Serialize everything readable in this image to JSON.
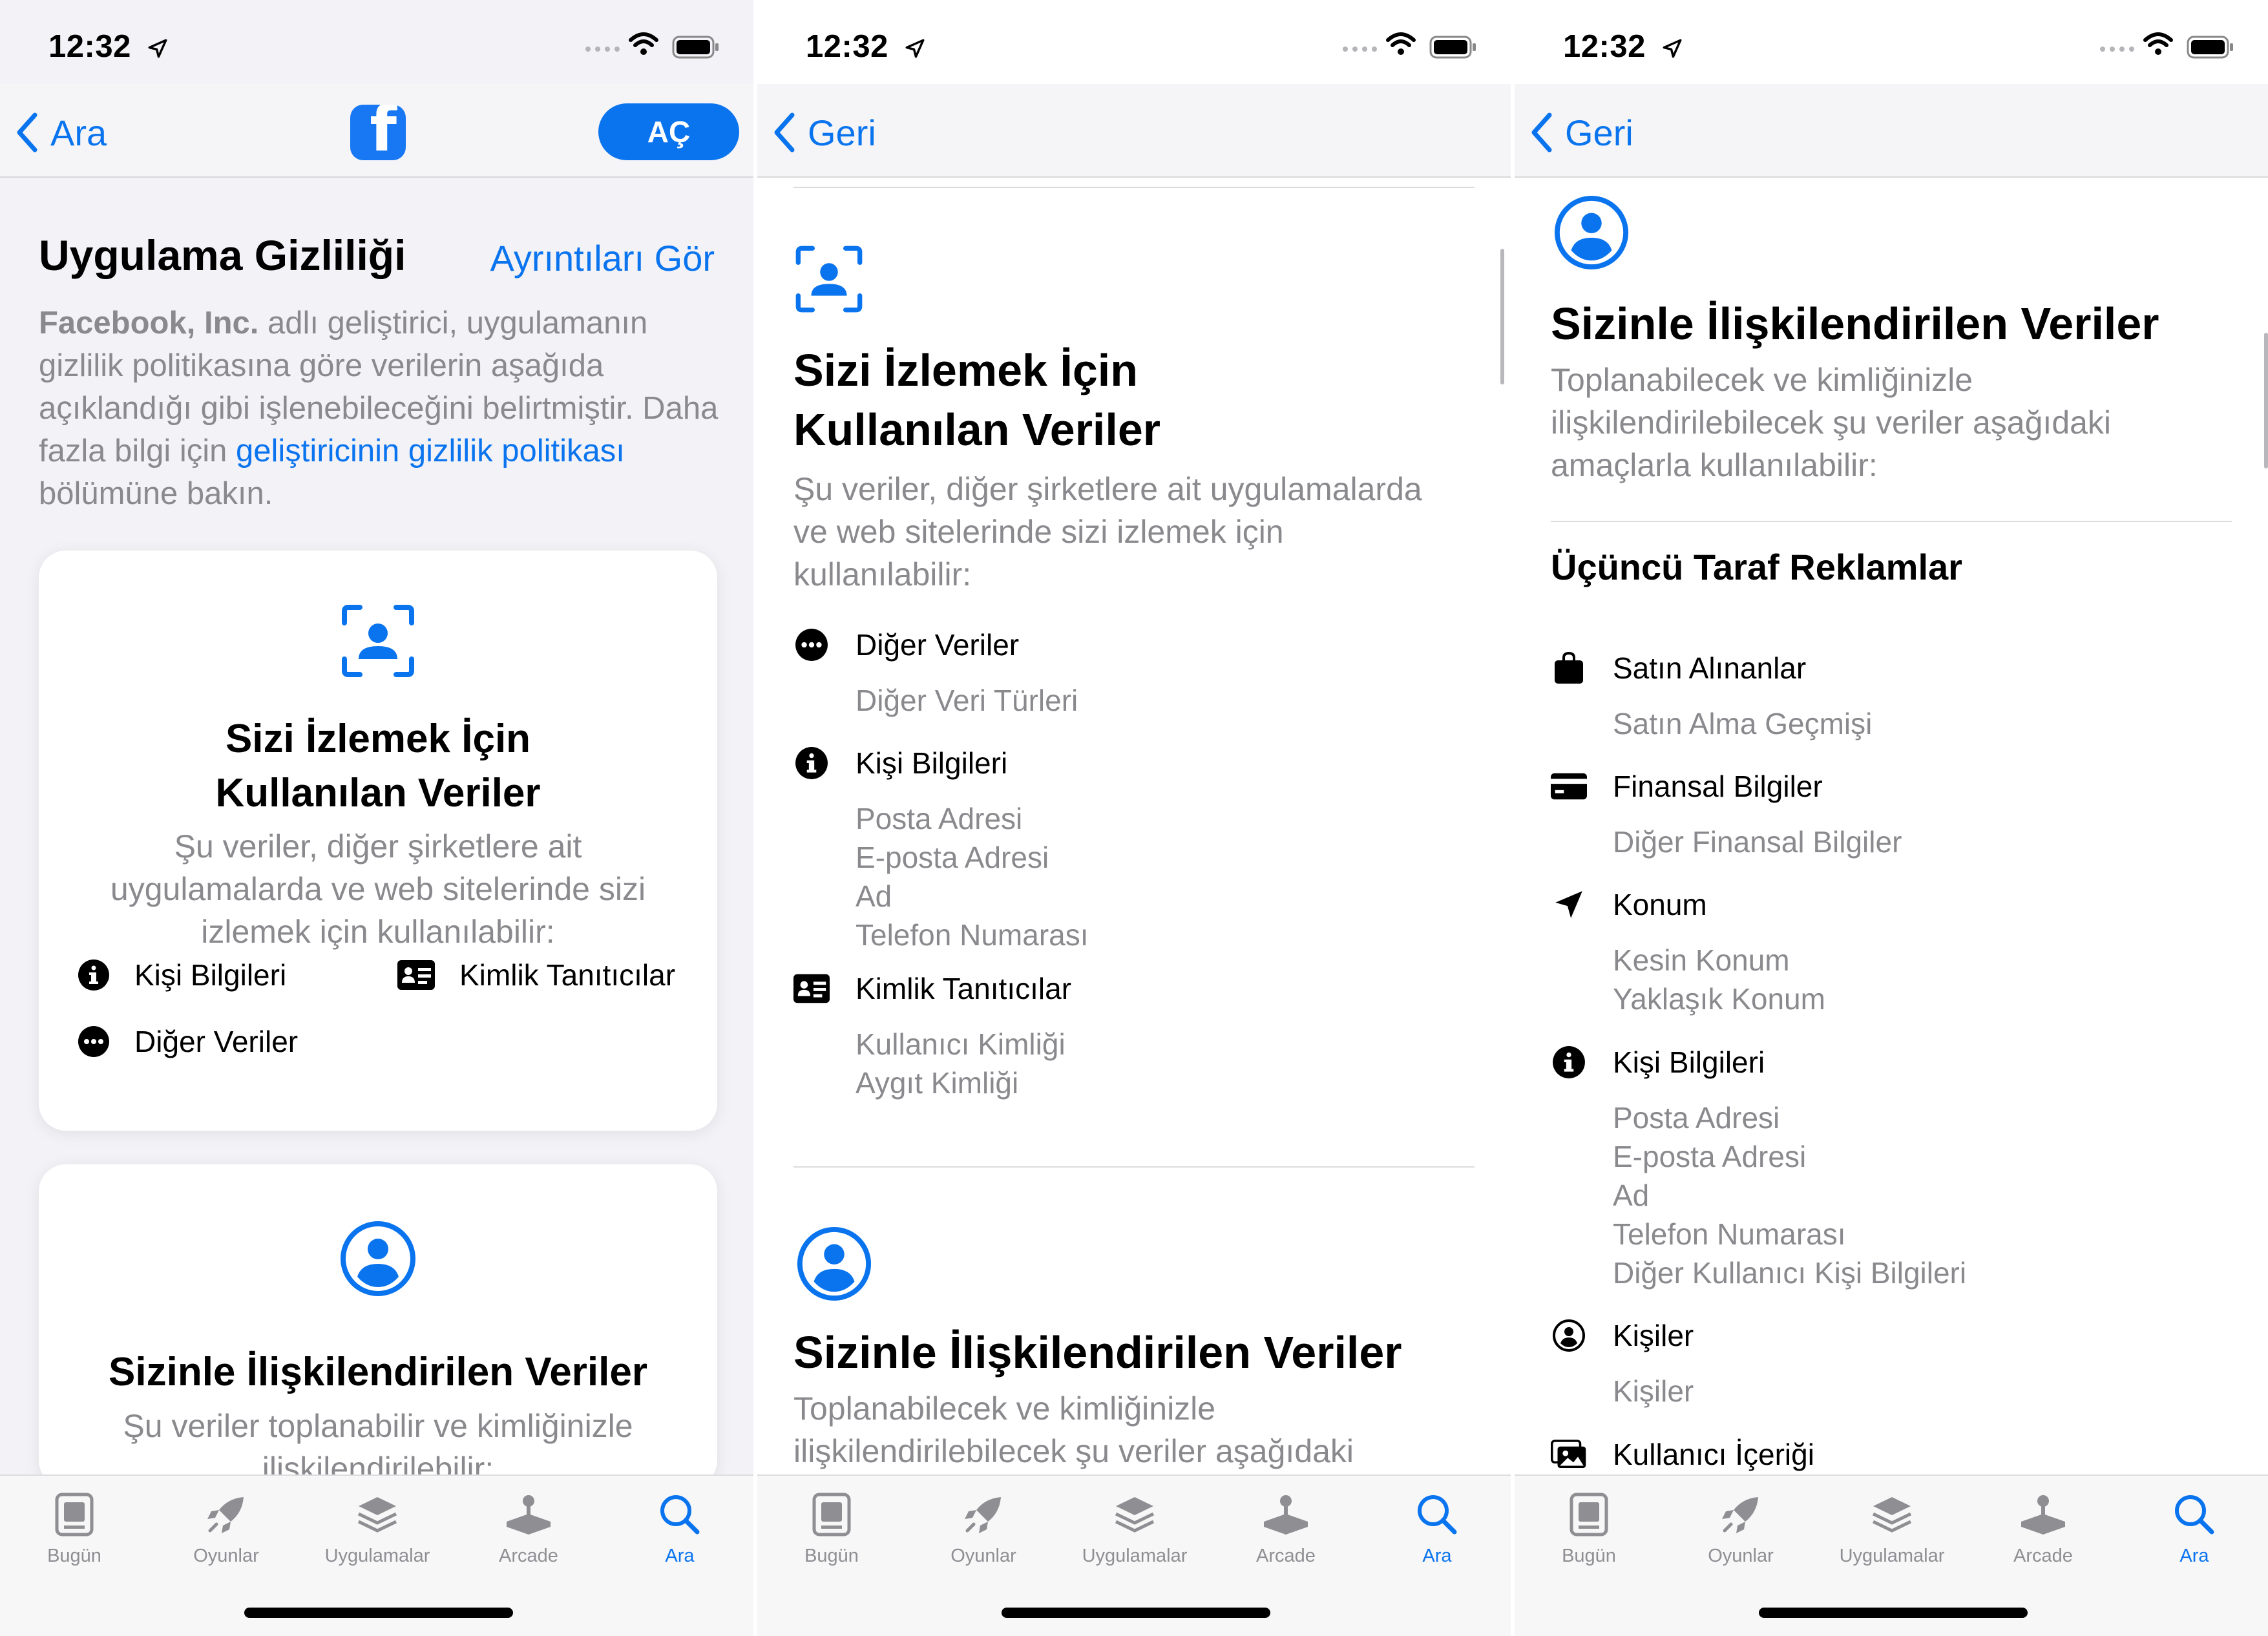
{
  "status": {
    "time": "12:32"
  },
  "panel1": {
    "nav": {
      "back_label": "Ara",
      "open_label": "AÇ"
    },
    "section_title": "Uygulama Gizliliği",
    "see_details": "Ayrıntıları Gör",
    "intro": {
      "developer": "Facebook, Inc.",
      "text1": " adlı geliştirici, uygulamanın gizlilik politikasına göre verilerin aşağıda açıklandığı gibi işlenebileceğini belirtmiştir. Daha fazla bilgi için ",
      "link": "geliştiricinin gizlilik politikası",
      "text2": " bölümüne bakın."
    },
    "card1": {
      "title_line1": "Sizi İzlemek İçin",
      "title_line2": "Kullanılan Veriler",
      "desc": "Şu veriler, diğer şirketlere ait uygulamalarda ve web sitelerinde sizi izlemek için kullanılabilir:",
      "items": [
        "Kişi Bilgileri",
        "Kimlik Tanıtıcılar",
        "Diğer Veriler"
      ]
    },
    "card2": {
      "title": "Sizinle İlişkilendirilen Veriler",
      "desc": "Şu veriler toplanabilir ve kimliğinizle ilişkilendirilebilir:"
    }
  },
  "panel2": {
    "nav": {
      "back_label": "Geri"
    },
    "title_line1": "Sizi İzlemek İçin",
    "title_line2": "Kullanılan Veriler",
    "desc": "Şu veriler, diğer şirketlere ait uygulamalarda ve web sitelerinde sizi izlemek için kullanılabilir:",
    "groups": [
      {
        "label": "Diğer Veriler",
        "icon": "more-icon",
        "items": [
          "Diğer Veri Türleri"
        ]
      },
      {
        "label": "Kişi Bilgileri",
        "icon": "info-icon",
        "items": [
          "Posta Adresi",
          "E-posta Adresi",
          "Ad",
          "Telefon Numarası"
        ]
      },
      {
        "label": "Kimlik Tanıtıcılar",
        "icon": "id-card-icon",
        "items": [
          "Kullanıcı Kimliği",
          "Aygıt Kimliği"
        ]
      }
    ],
    "linked_title": "Sizinle İlişkilendirilen Veriler",
    "linked_desc": "Toplanabilecek ve kimliğinizle ilişkilendirilebilecek şu veriler aşağıdaki"
  },
  "panel3": {
    "nav": {
      "back_label": "Geri"
    },
    "title": "Sizinle İlişkilendirilen Veriler",
    "desc": "Toplanabilecek ve kimliğinizle ilişkilendirilebilecek şu veriler aşağıdaki amaçlarla kullanılabilir:",
    "subheading": "Üçüncü Taraf Reklamlar",
    "groups": [
      {
        "label": "Satın Alınanlar",
        "icon": "bag-icon",
        "items": [
          "Satın Alma Geçmişi"
        ]
      },
      {
        "label": "Finansal Bilgiler",
        "icon": "credit-card-icon",
        "items": [
          "Diğer Finansal Bilgiler"
        ]
      },
      {
        "label": "Konum",
        "icon": "location-arrow-icon",
        "items": [
          "Kesin Konum",
          "Yaklaşık Konum"
        ]
      },
      {
        "label": "Kişi Bilgileri",
        "icon": "info-icon",
        "items": [
          "Posta Adresi",
          "E-posta Adresi",
          "Ad",
          "Telefon Numarası",
          "Diğer Kullanıcı Kişi Bilgileri"
        ]
      },
      {
        "label": "Kişiler",
        "icon": "person-circle-icon",
        "items": [
          "Kişiler"
        ]
      },
      {
        "label": "Kullanıcı İçeriği",
        "icon": "photos-icon",
        "items": []
      }
    ]
  },
  "tabbar": {
    "tabs": [
      {
        "label": "Bugün",
        "icon": "today-icon"
      },
      {
        "label": "Oyunlar",
        "icon": "rocket-icon"
      },
      {
        "label": "Uygulamalar",
        "icon": "layers-icon"
      },
      {
        "label": "Arcade",
        "icon": "joystick-icon"
      },
      {
        "label": "Ara",
        "icon": "search-icon",
        "active": true
      }
    ]
  },
  "colors": {
    "accent": "#0a74ef",
    "secondary_text": "#8a8a8e",
    "facebook": "#1877f2"
  }
}
